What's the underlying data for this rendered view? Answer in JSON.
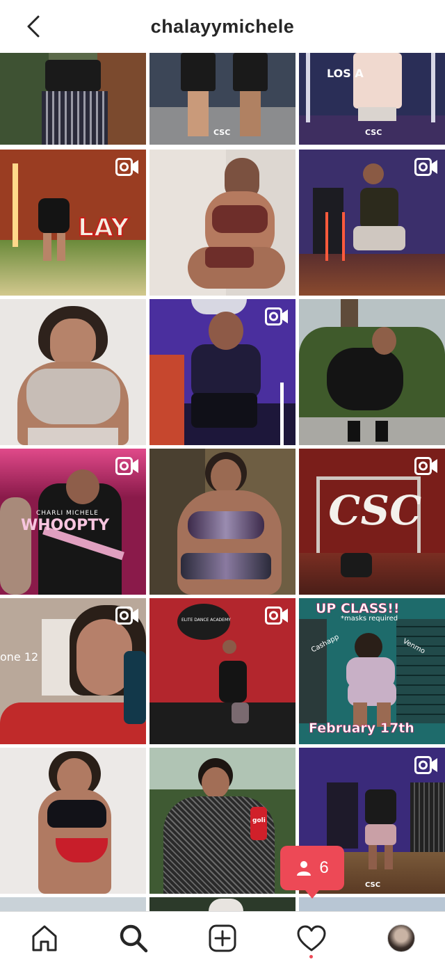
{
  "header": {
    "username": "chalayymichele",
    "back_icon": "chevron-left-icon"
  },
  "tiles": [
    {
      "row": 0,
      "col": 0,
      "video": false,
      "bg": "#5b6a4a"
    },
    {
      "row": 0,
      "col": 1,
      "video": false,
      "bg": "#3c4657",
      "caption": "CSC"
    },
    {
      "row": 0,
      "col": 2,
      "video": false,
      "bg": "#2a2e57",
      "caption": "LOS A",
      "caption2": "CSC"
    },
    {
      "row": 1,
      "col": 0,
      "video": true,
      "bg": "#9a3d22",
      "caption": "LAY"
    },
    {
      "row": 1,
      "col": 1,
      "video": false,
      "bg": "#e8e2dc"
    },
    {
      "row": 1,
      "col": 2,
      "video": true,
      "bg": "#3b2f6b"
    },
    {
      "row": 2,
      "col": 0,
      "video": false,
      "bg": "#eae7e4"
    },
    {
      "row": 2,
      "col": 1,
      "video": true,
      "bg": "#4a2f9e"
    },
    {
      "row": 2,
      "col": 2,
      "video": false,
      "bg": "#4f6b35"
    },
    {
      "row": 3,
      "col": 0,
      "video": true,
      "bg": "#8a1a4a",
      "caption": "WHOOPTY",
      "caption2": "CHARLI MICHELE"
    },
    {
      "row": 3,
      "col": 1,
      "video": false,
      "bg": "#6e5e43"
    },
    {
      "row": 3,
      "col": 2,
      "video": true,
      "bg": "#7a1e1a",
      "caption": "CSC"
    },
    {
      "row": 4,
      "col": 0,
      "video": true,
      "bg": "#b9a89a",
      "caption": "one 12"
    },
    {
      "row": 4,
      "col": 1,
      "video": true,
      "bg": "#b3262d",
      "caption": "ELITE DANCE ACADEMY"
    },
    {
      "row": 4,
      "col": 2,
      "video": false,
      "bg": "#1e6b6b",
      "caption": "UP CLASS!!",
      "caption2": "*masks required",
      "caption3": "February 17th",
      "caption4": "Cashapp",
      "caption5": "Venmo"
    },
    {
      "row": 5,
      "col": 0,
      "video": false,
      "bg": "#ece9e7"
    },
    {
      "row": 5,
      "col": 1,
      "video": false,
      "bg": "#3f5a33",
      "caption": "goli"
    },
    {
      "row": 5,
      "col": 2,
      "video": true,
      "bg": "#3a2a7a",
      "caption": "CSC"
    }
  ],
  "notification": {
    "count": "6",
    "icon": "person-icon",
    "color": "#ed4956"
  },
  "nav": {
    "items": [
      {
        "name": "home-icon"
      },
      {
        "name": "search-icon"
      },
      {
        "name": "new-post-icon"
      },
      {
        "name": "heart-icon"
      },
      {
        "name": "profile-avatar"
      }
    ]
  }
}
